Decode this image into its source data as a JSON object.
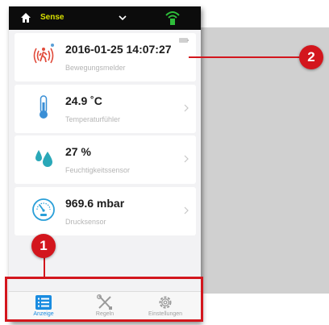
{
  "topbar": {
    "title": "Sense",
    "home_icon": "home-icon",
    "dropdown_icon": "chevron-down-icon",
    "status_icon": "wifi-signal-icon",
    "accent_color": "#d8e000",
    "signal_color": "#2ebd3a"
  },
  "sensors": [
    {
      "value": "2016-01-25 14:07:27",
      "label": "Bewegungsmelder",
      "icon": "motion-sensor-icon"
    },
    {
      "value": "24.9 ˚C",
      "label": "Temperaturfühler",
      "icon": "thermometer-icon"
    },
    {
      "value": "27 %",
      "label": "Feuchtigkeitssensor",
      "icon": "water-drop-icon"
    },
    {
      "value": "969.6 mbar",
      "label": "Drucksensor",
      "icon": "pressure-gauge-icon"
    }
  ],
  "tabbar": {
    "tabs": [
      {
        "label": "Anzeige",
        "icon": "list-icon",
        "active": true
      },
      {
        "label": "Regeln",
        "icon": "tools-icon",
        "active": false
      },
      {
        "label": "Einstellungen",
        "icon": "gear-icon",
        "active": false
      }
    ],
    "active_color": "#1a8ce0"
  },
  "annotations": {
    "badge_1": "1",
    "badge_2": "2",
    "color": "#d3161d"
  }
}
